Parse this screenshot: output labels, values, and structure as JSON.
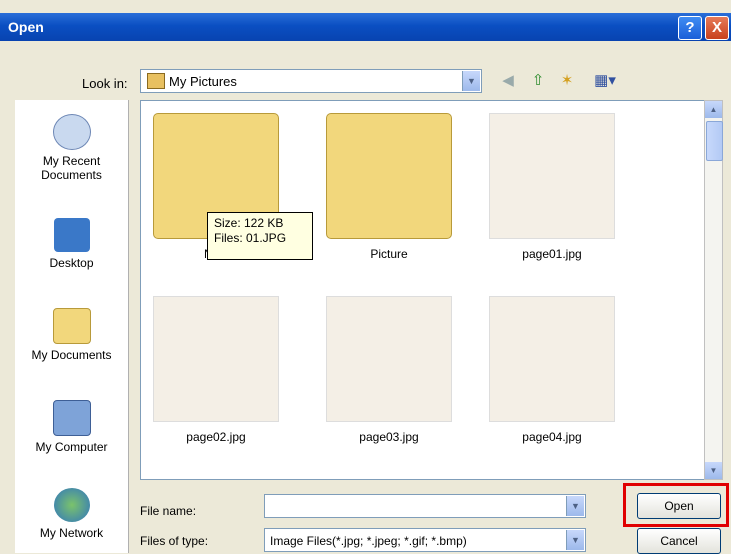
{
  "dialog": {
    "title": "Open",
    "help": "?",
    "close": "X"
  },
  "toolbar": {
    "look_in_label": "Look in:",
    "look_in_value": "My Pictures"
  },
  "places": [
    {
      "label": "My Recent Documents"
    },
    {
      "label": "Desktop"
    },
    {
      "label": "My Documents"
    },
    {
      "label": "My Computer"
    },
    {
      "label": "My Network"
    }
  ],
  "files": [
    {
      "name": "New",
      "type": "folder"
    },
    {
      "name": "Picture",
      "type": "folder"
    },
    {
      "name": "page01.jpg",
      "type": "image"
    },
    {
      "name": "page02.jpg",
      "type": "image"
    },
    {
      "name": "page03.jpg",
      "type": "image"
    },
    {
      "name": "page04.jpg",
      "type": "image"
    }
  ],
  "tooltip": {
    "size": "Size: 122 KB",
    "files": "Files: 01.JPG"
  },
  "footer": {
    "file_name_label": "File name:",
    "file_name_value": "",
    "file_type_label": "Files of type:",
    "file_type_value": "Image Files(*.jpg; *.jpeg; *.gif; *.bmp)",
    "open_label": "Open",
    "cancel_label": "Cancel"
  },
  "colors": {
    "highlight": "#e00000",
    "titlebar": "#0a4fc2"
  }
}
